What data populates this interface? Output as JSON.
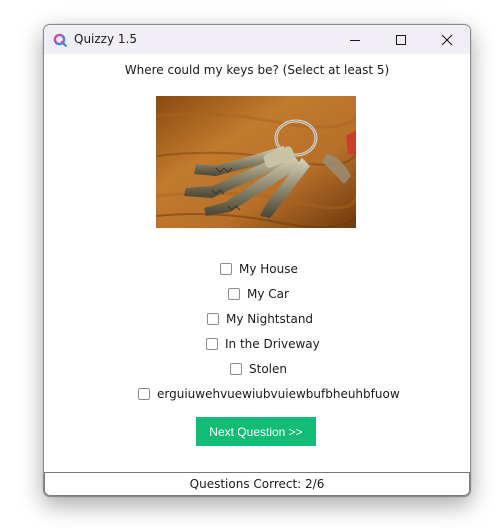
{
  "window": {
    "title": "Quizzy 1.5",
    "app_icon": "quizzy-q-logo-icon",
    "controls": [
      "minimize-icon",
      "maximize-icon",
      "close-icon"
    ]
  },
  "quiz": {
    "question": "Where could my keys be? (Select at least 5)",
    "image": "photo-of-keys-on-wooden-table",
    "options": [
      {
        "label": "My House",
        "checked": false
      },
      {
        "label": "My Car",
        "checked": false
      },
      {
        "label": "My Nightstand",
        "checked": false
      },
      {
        "label": "In the Driveway",
        "checked": false
      },
      {
        "label": "Stolen",
        "checked": false
      },
      {
        "label": "erguiuwehvuewiubvuiewbufbheuhbfuow",
        "checked": false
      }
    ],
    "next_button_label": "Next Question >>",
    "accent_color": "#12bb76"
  },
  "status": {
    "text": "Questions Correct: 2/6"
  }
}
